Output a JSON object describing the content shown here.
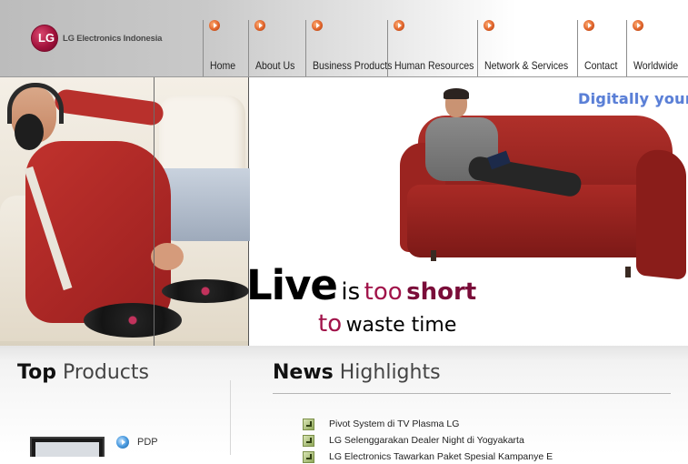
{
  "header": {
    "logo_text": "LG Electronics Indonesia",
    "logo_mark": "LG",
    "nav": [
      {
        "label": "Home"
      },
      {
        "label": "About Us"
      },
      {
        "label": "Business Products"
      },
      {
        "label": "Human Resources"
      },
      {
        "label": "Network & Services"
      },
      {
        "label": "Contact"
      },
      {
        "label": "Worldwide"
      }
    ]
  },
  "banner": {
    "tagline": "Digitally your",
    "slogan_live": "Live",
    "slogan_is": "is",
    "slogan_too": "too",
    "slogan_short": "short",
    "slogan_to": "to",
    "slogan_rest": "waste time"
  },
  "top_products": {
    "title_bold": "Top",
    "title_light": "Products",
    "items": [
      {
        "label": "PDP"
      }
    ]
  },
  "news": {
    "title_bold": "News",
    "title_light": "Highlights",
    "items": [
      {
        "text": "Pivot System di TV Plasma LG"
      },
      {
        "text": "LG Selenggarakan Dealer Night di Yogyakarta"
      },
      {
        "text": "LG Electronics Tawarkan Paket Spesial Kampanye E"
      }
    ]
  },
  "colors": {
    "accent_maroon": "#a1134a",
    "tagline_blue": "#5a7fd6",
    "nav_bullet_orange": "#e0632a"
  }
}
